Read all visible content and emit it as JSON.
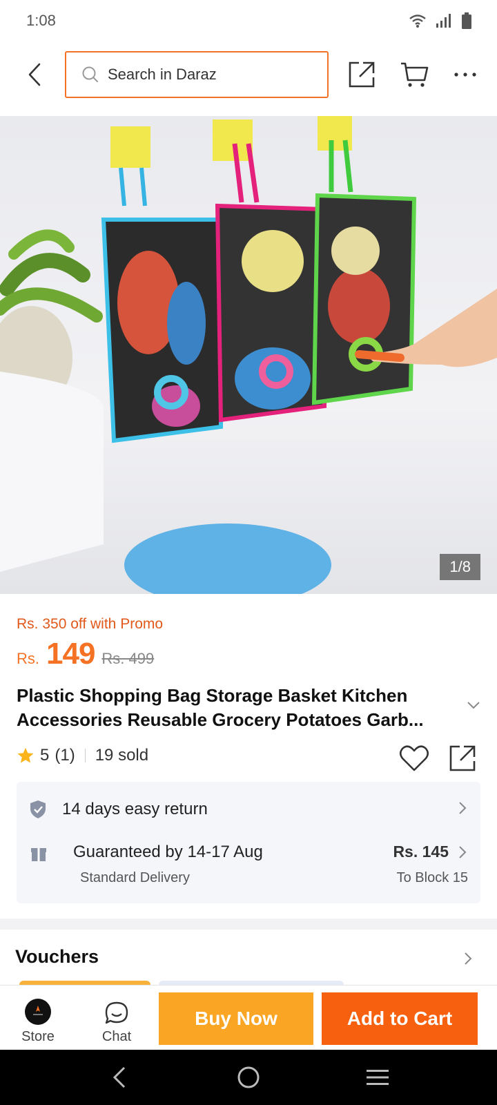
{
  "status_bar": {
    "time": "1:08",
    "icons": [
      "wifi-icon",
      "signal-icon",
      "battery-icon"
    ]
  },
  "header": {
    "search_placeholder": "Search in Daraz",
    "icons": [
      "back-arrow-icon",
      "search-icon",
      "share-icon",
      "cart-icon",
      "more-icon"
    ]
  },
  "gallery": {
    "counter": "1/8",
    "current_index": 1,
    "total_images": 8
  },
  "product": {
    "promo": "Rs. 350 off with Promo",
    "currency": "Rs.",
    "price": "149",
    "original_price": "Rs. 499",
    "title": "Plastic Shopping Bag Storage Basket Kitchen Accessories Reusable Grocery Potatoes Garb...",
    "rating": "5",
    "rating_count": "(1)",
    "sold": "19 sold"
  },
  "info": {
    "return_text": "14 days easy return",
    "shipping_title": "Guaranteed by 14-17 Aug",
    "shipping_method": "Standard Delivery",
    "shipping_price": "Rs. 145",
    "shipping_destination": "To Block 15"
  },
  "vouchers": {
    "title": "Vouchers"
  },
  "bottom_bar": {
    "store_label": "Store",
    "chat_label": "Chat",
    "buy_now_label": "Buy Now",
    "add_to_cart_label": "Add to Cart"
  },
  "colors": {
    "brand_orange": "#f57224",
    "buy_now": "#fba524",
    "add_to_cart": "#f7600f",
    "star": "#fbb41b"
  }
}
